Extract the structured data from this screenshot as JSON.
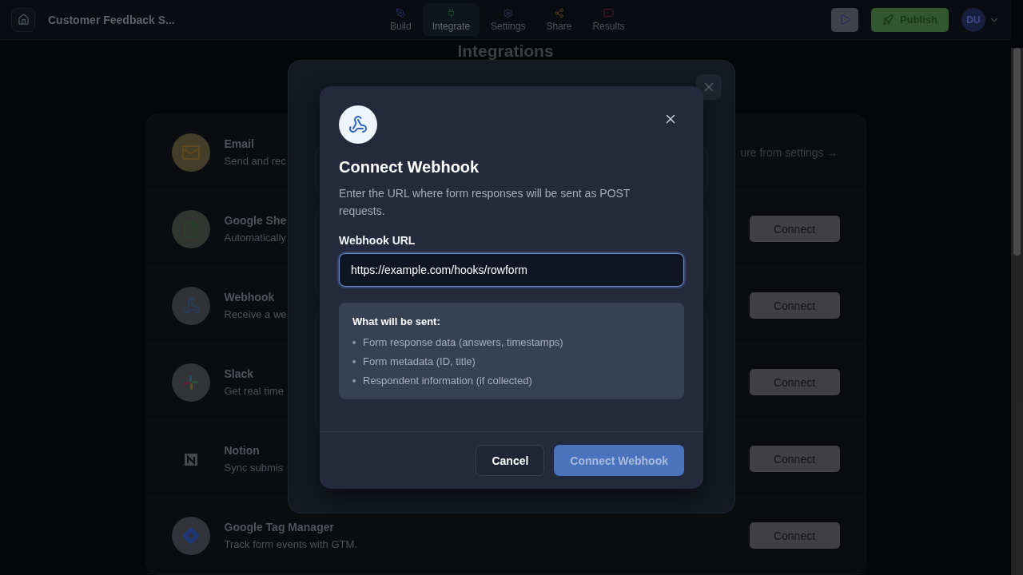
{
  "top_bar": {
    "title": "Customer Feedback S...",
    "tabs": [
      {
        "kind": "build",
        "label": "Build",
        "selected": false
      },
      {
        "kind": "integrate",
        "label": "Integrate",
        "selected": true
      },
      {
        "kind": "settings",
        "label": "Settings",
        "selected": false
      },
      {
        "kind": "share",
        "label": "Share",
        "selected": false
      },
      {
        "kind": "results",
        "label": "Results",
        "selected": false
      }
    ],
    "publish": "Publish",
    "avatar": "DU"
  },
  "page": {
    "heading": "Integrations"
  },
  "integrations": [
    {
      "kind": "email",
      "name": "Email",
      "description": "Send and rec",
      "action": {
        "kind": "link",
        "label": "ure from settings →"
      }
    },
    {
      "kind": "sheets",
      "name": "Google She",
      "description": "Automatically",
      "action": {
        "kind": "button",
        "label": "Connect"
      }
    },
    {
      "kind": "webhook",
      "name": "Webhook",
      "description": "Receive a we",
      "action": {
        "kind": "button",
        "label": "Connect"
      }
    },
    {
      "kind": "slack",
      "name": "Slack",
      "description": "Get real time",
      "action": {
        "kind": "button",
        "label": "Connect"
      }
    },
    {
      "kind": "notion",
      "name": "Notion",
      "description": "Sync submis",
      "action": {
        "kind": "button",
        "label": "Connect"
      }
    },
    {
      "kind": "gtm",
      "name": "Google Tag Manager",
      "description": "Track form events with GTM.",
      "action": {
        "kind": "button",
        "label": "Connect"
      }
    }
  ],
  "dialog": {
    "title": "Connect Webhook",
    "description": "Enter the URL where form responses will be sent as POST requests.",
    "field": {
      "label": "Webhook URL",
      "value": "https://example.com/hooks/rowform",
      "focused": true
    },
    "info": {
      "heading": "What will be sent:",
      "items": [
        "Form response data (answers, timestamps)",
        "Form metadata (ID, title)",
        "Respondent information (if collected)"
      ]
    },
    "buttons": [
      {
        "kind": "secondary",
        "label": "Cancel",
        "disabled": false
      },
      {
        "kind": "primary",
        "label": "Connect Webhook",
        "disabled": true
      }
    ]
  }
}
